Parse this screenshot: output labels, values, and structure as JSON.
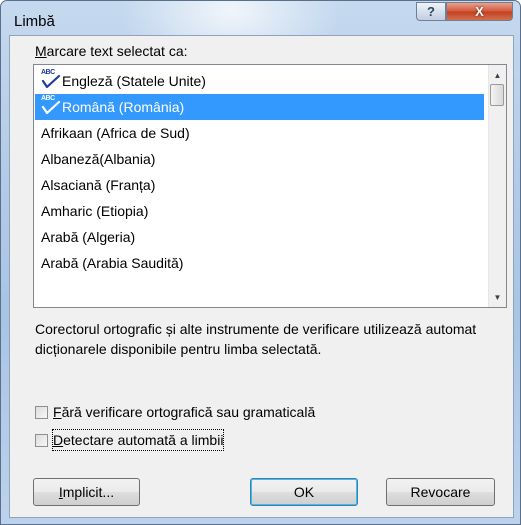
{
  "window": {
    "title": "Limbă",
    "help_button": "?",
    "close_button": "X"
  },
  "dialog": {
    "mark_label": "Marcare text selectat ca:",
    "languages": [
      {
        "label": "Engleză (Statele Unite)",
        "has_spell_icon": true,
        "selected": false
      },
      {
        "label": "Română (România)",
        "has_spell_icon": true,
        "selected": true
      },
      {
        "label": "Afrikaan (Africa de Sud)",
        "has_spell_icon": false,
        "selected": false
      },
      {
        "label": "Albaneză(Albania)",
        "has_spell_icon": false,
        "selected": false
      },
      {
        "label": "Alsaciană (Franța)",
        "has_spell_icon": false,
        "selected": false
      },
      {
        "label": "Amharic (Etiopia)",
        "has_spell_icon": false,
        "selected": false
      },
      {
        "label": "Arabă (Algeria)",
        "has_spell_icon": false,
        "selected": false
      },
      {
        "label": "Arabă (Arabia Saudită)",
        "has_spell_icon": false,
        "selected": false
      }
    ],
    "spell_icon_text": "ABC",
    "scroll_up": "▲",
    "scroll_down": "▼",
    "description": "Corectorul ortografic și alte instrumente de verificare utilizează automat dicționarele disponibile pentru limba selectată.",
    "no_proofing": {
      "label_underlined": "F",
      "label_rest": "ără verificare ortografică sau gramaticală",
      "checked": false
    },
    "detect_language": {
      "label_underlined": "D",
      "label_rest": "etectare automată a limbii",
      "checked": false
    },
    "buttons": {
      "default_underlined": "I",
      "default_rest": "mplicit...",
      "ok": "OK",
      "cancel": "Revocare"
    }
  },
  "colors": {
    "selection": "#3399ff",
    "spell_check_mark": "#1d3c9e",
    "close_button": "#c94a2b"
  }
}
